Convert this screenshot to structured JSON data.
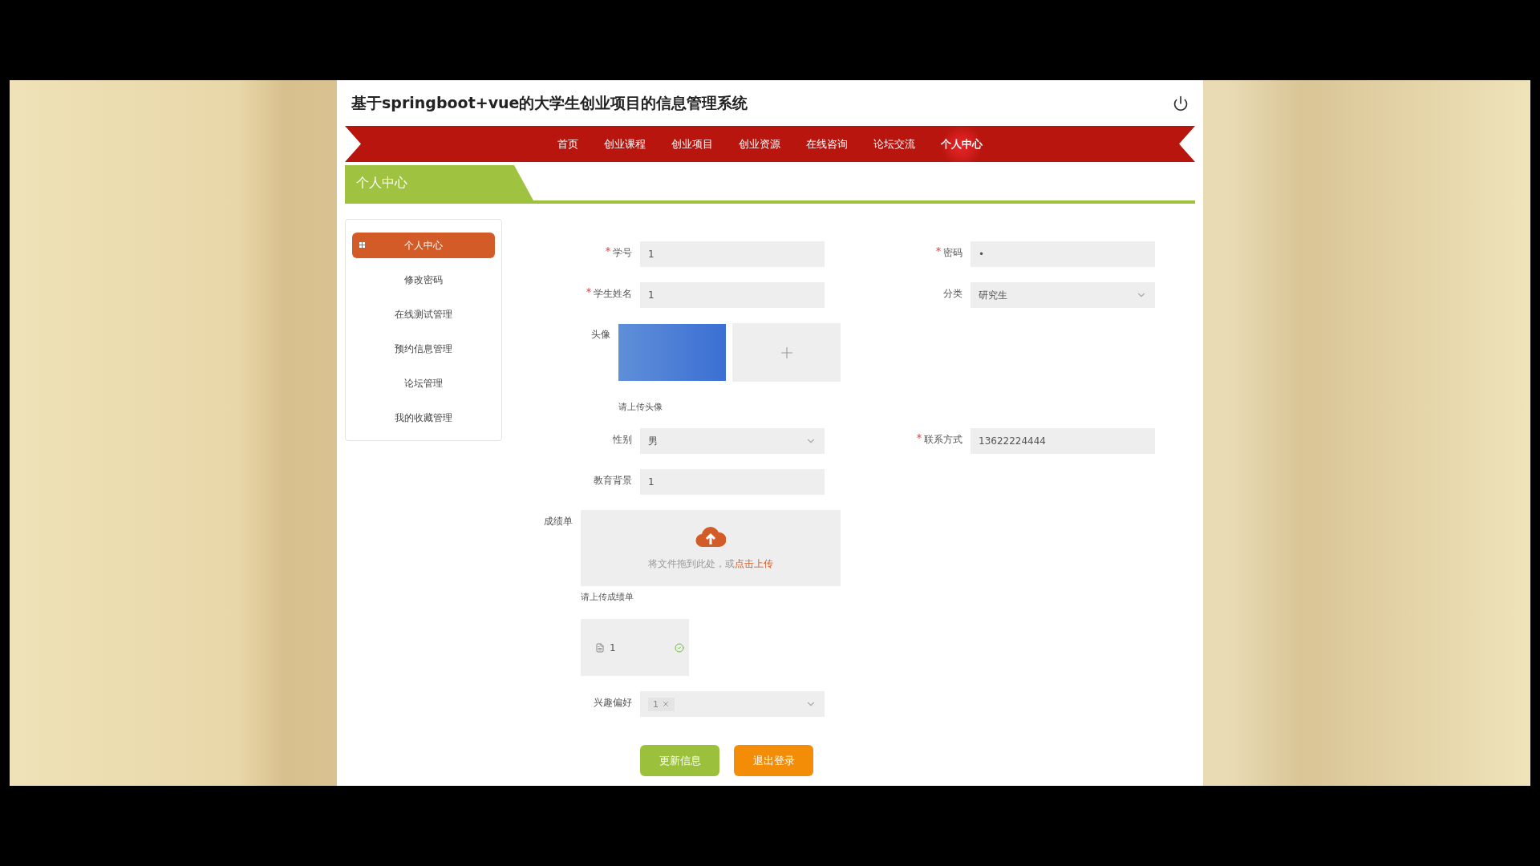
{
  "header": {
    "title": "基于springboot+vue的大学生创业项目的信息管理系统"
  },
  "nav": [
    {
      "label": "首页",
      "selected": false
    },
    {
      "label": "创业课程",
      "selected": false
    },
    {
      "label": "创业项目",
      "selected": false
    },
    {
      "label": "创业资源",
      "selected": false
    },
    {
      "label": "在线咨询",
      "selected": false
    },
    {
      "label": "论坛交流",
      "selected": false
    },
    {
      "label": "个人中心",
      "selected": true
    }
  ],
  "section_title": "个人中心",
  "sidebar": [
    {
      "label": "个人中心",
      "selected": true
    },
    {
      "label": "修改密码",
      "selected": false
    },
    {
      "label": "在线测试管理",
      "selected": false
    },
    {
      "label": "预约信息管理",
      "selected": false
    },
    {
      "label": "论坛管理",
      "selected": false
    },
    {
      "label": "我的收藏管理",
      "selected": false
    }
  ],
  "form": {
    "rows": [
      [
        {
          "kind": "input",
          "label": "学号",
          "required": true,
          "value": "1"
        },
        {
          "kind": "input",
          "label": "密码",
          "required": true,
          "value": "•"
        }
      ],
      [
        {
          "kind": "input",
          "label": "学生姓名",
          "required": true,
          "value": "1"
        },
        {
          "kind": "select",
          "label": "分类",
          "required": false,
          "value": "研究生"
        }
      ],
      [
        {
          "kind": "image",
          "label": "头像",
          "required": false,
          "hint": "请上传头像"
        }
      ],
      [
        {
          "kind": "select",
          "label": "性别",
          "required": false,
          "value": "男"
        },
        {
          "kind": "input",
          "label": "联系方式",
          "required": true,
          "value": "13622224444"
        }
      ],
      [
        {
          "kind": "input",
          "label": "教育背景",
          "required": false,
          "value": "1"
        }
      ],
      [
        {
          "kind": "upload",
          "label": "成绩单",
          "required": false,
          "drop_text": "将文件拖到此处，或",
          "link": "点击上传",
          "hint": "请上传成绩单",
          "files": [
            {
              "name": "1",
              "uploaded": true
            }
          ]
        }
      ],
      [
        {
          "kind": "tags",
          "label": "兴趣偏好",
          "required": false,
          "tags": [
            "1"
          ]
        }
      ]
    ]
  },
  "buttons": [
    {
      "label": "更新信息",
      "kind": "primary"
    },
    {
      "label": "退出登录",
      "kind": "warning"
    }
  ]
}
